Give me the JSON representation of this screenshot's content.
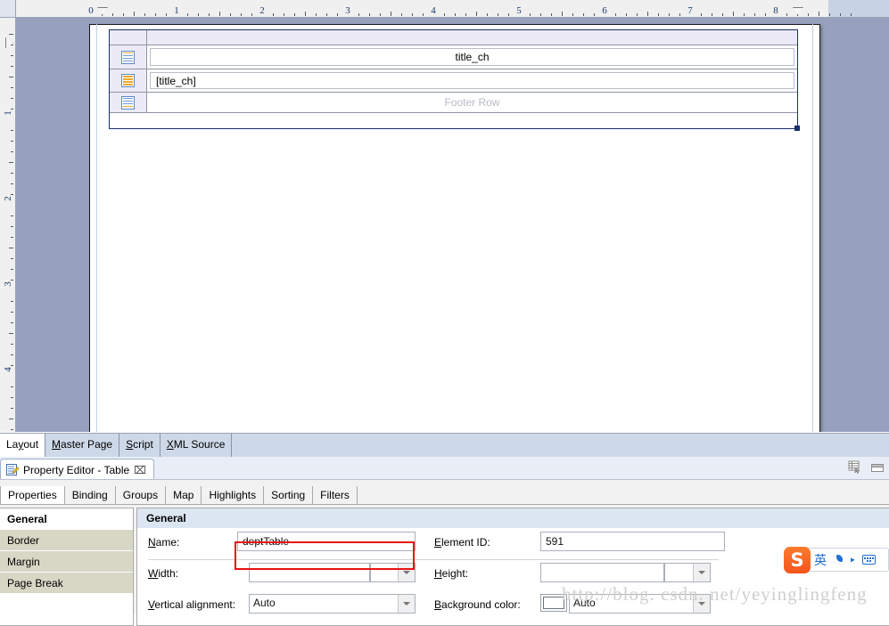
{
  "ruler": {
    "horizontal_labels": [
      "0",
      "1",
      "2",
      "3",
      "4",
      "5",
      "6",
      "7",
      "8"
    ],
    "vertical_labels": [
      "1",
      "2",
      "3",
      "4"
    ],
    "unit": "inch"
  },
  "canvas": {
    "table": {
      "header_row_text": "title_ch",
      "detail_row_text": "[title_ch]",
      "footer_row_text": "Footer Row",
      "row_icon_names": [
        "table-header-row-icon",
        "table-detail-row-icon",
        "table-footer-row-icon"
      ]
    }
  },
  "editor_tabs": [
    {
      "label": "Layout",
      "active": true
    },
    {
      "label": "Master Page",
      "active": false
    },
    {
      "label": "Script",
      "active": false
    },
    {
      "label": "XML Source",
      "active": false
    }
  ],
  "property_view": {
    "title": "Property Editor - Table",
    "close_label": "⌧",
    "tabs": [
      {
        "label": "Properties",
        "active": true
      },
      {
        "label": "Binding",
        "active": false
      },
      {
        "label": "Groups",
        "active": false
      },
      {
        "label": "Map",
        "active": false
      },
      {
        "label": "Highlights",
        "active": false
      },
      {
        "label": "Sorting",
        "active": false
      },
      {
        "label": "Filters",
        "active": false
      }
    ],
    "categories": [
      {
        "label": "General",
        "selected": true
      },
      {
        "label": "Border",
        "selected": false
      },
      {
        "label": "Margin",
        "selected": false
      },
      {
        "label": "Page Break",
        "selected": false
      }
    ],
    "pane_title": "General",
    "fields": {
      "name_label": "Name:",
      "name_value": "deptTable",
      "element_id_label": "Element ID:",
      "element_id_value": "591",
      "width_label": "Width:",
      "width_value": "",
      "width_unit": "",
      "height_label": "Height:",
      "height_value": "",
      "height_unit": "",
      "valign_label": "Vertical alignment:",
      "valign_value": "Auto",
      "bgcolor_label": "Background color:",
      "bgcolor_value": "Auto"
    },
    "highlight_color": "#e81313"
  },
  "ime": {
    "logo_text": "S",
    "mode_label": "英",
    "icons": [
      "moon-icon",
      "comma-icon",
      "keyboard-icon"
    ]
  },
  "watermark": {
    "text": "http://blog. csdn. net/yeyinglingfeng"
  }
}
